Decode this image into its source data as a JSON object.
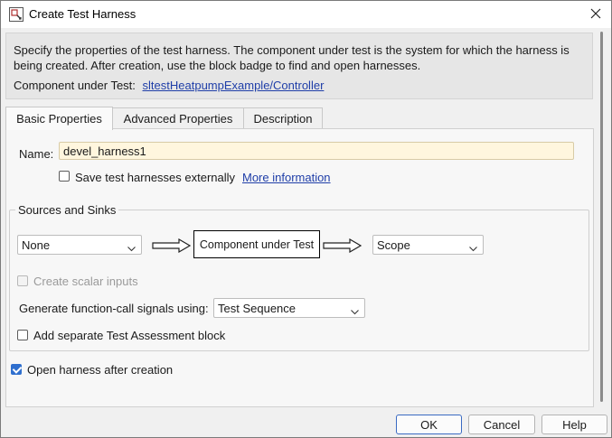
{
  "window": {
    "title": "Create Test Harness",
    "app_icon": "simulink-harness-icon",
    "close_icon": "close-icon"
  },
  "description": {
    "text": "Specify the properties of the test harness. The component under test is the system for which the harness is being created. After creation, use the block badge to find and open harnesses.",
    "cut_label": "Component under Test:",
    "cut_link": "sltestHeatpumpExample/Controller"
  },
  "tabs": [
    {
      "label": "Basic Properties",
      "active": true
    },
    {
      "label": "Advanced Properties",
      "active": false
    },
    {
      "label": "Description",
      "active": false
    }
  ],
  "basic": {
    "name_label": "Name:",
    "name_value": "devel_harness1",
    "save_externally_label": "Save test harnesses externally",
    "save_externally_checked": false,
    "more_info_link": "More information",
    "sources_sinks": {
      "title": "Sources and Sinks",
      "source_value": "None",
      "cut_box_label": "Component under Test",
      "sink_value": "Scope",
      "create_scalar_label": "Create scalar inputs",
      "create_scalar_checked": false,
      "create_scalar_enabled": false,
      "fcall_label": "Generate function-call signals using:",
      "fcall_value": "Test Sequence",
      "assessment_label": "Add separate Test Assessment block",
      "assessment_checked": false
    },
    "open_after_label": "Open harness after creation",
    "open_after_checked": true
  },
  "buttons": {
    "ok": "OK",
    "cancel": "Cancel",
    "help": "Help"
  },
  "colors": {
    "accent": "#2f6fce",
    "link": "#1f3ea8",
    "name_field_bg": "#fff6de"
  }
}
